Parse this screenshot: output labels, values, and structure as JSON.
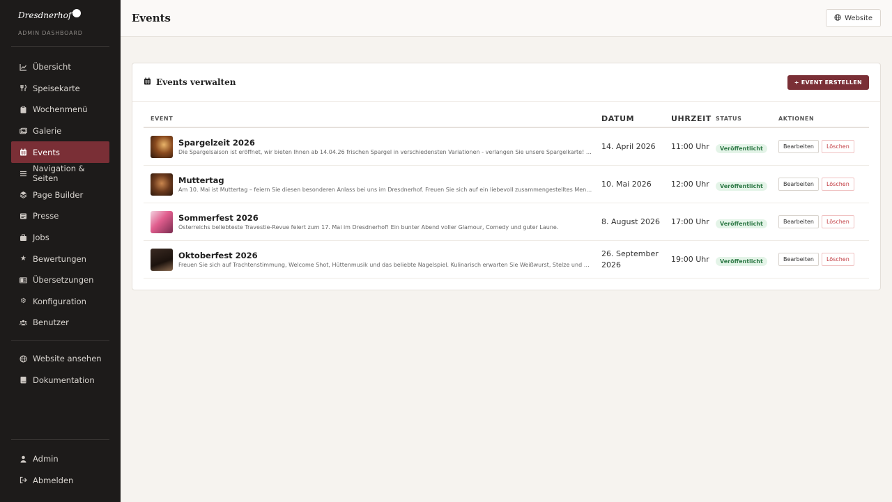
{
  "brand": {
    "logo_text": "Dresdnerhof",
    "subtitle": "ADMIN DASHBOARD"
  },
  "sidebar": {
    "items": [
      {
        "label": "Übersicht",
        "icon": "chart-line-icon"
      },
      {
        "label": "Speisekarte",
        "icon": "utensils-icon"
      },
      {
        "label": "Wochenmenü",
        "icon": "clipboard-icon"
      },
      {
        "label": "Galerie",
        "icon": "images-icon"
      },
      {
        "label": "Events",
        "icon": "calendar-icon"
      },
      {
        "label": "Navigation & Seiten",
        "icon": "bars-icon"
      },
      {
        "label": "Page Builder",
        "icon": "layers-icon"
      },
      {
        "label": "Presse",
        "icon": "newspaper-icon"
      },
      {
        "label": "Jobs",
        "icon": "briefcase-icon"
      },
      {
        "label": "Bewertungen",
        "icon": "star-icon"
      },
      {
        "label": "Übersetzungen",
        "icon": "language-icon"
      },
      {
        "label": "Konfiguration",
        "icon": "gear-icon"
      },
      {
        "label": "Benutzer",
        "icon": "users-icon"
      }
    ],
    "active": "Events",
    "links": [
      {
        "label": "Website ansehen",
        "icon": "globe-icon"
      },
      {
        "label": "Dokumentation",
        "icon": "book-icon"
      }
    ],
    "bottom": [
      {
        "label": "Admin",
        "icon": "user-icon"
      },
      {
        "label": "Abmelden",
        "icon": "logout-icon"
      }
    ]
  },
  "header": {
    "title": "Events",
    "website_label": "Website"
  },
  "card": {
    "title": "Events verwalten",
    "create_label": "+ EVENT ERSTELLEN",
    "columns": {
      "event": "EVENT",
      "date": "DATUM",
      "time": "UHRZEIT",
      "status": "STATUS",
      "actions": "AKTIONEN"
    },
    "rows": [
      {
        "title": "Spargelzeit 2026",
        "desc": "Die Spargelsaison ist eröffnet, wir bieten Ihnen ab 14.04.26 frischen Spargel in verschiedensten Variationen - verlangen Sie unsere Spargelkarte! Guten...",
        "date": "14. April 2026",
        "time": "11:00 Uhr",
        "status": "Veröffentlicht",
        "edit": "Bearbeiten",
        "delete": "Löschen"
      },
      {
        "title": "Muttertag",
        "desc": "Am 10. Mai ist Muttertag – feiern Sie diesen besonderen Anlass bei uns im Dresdnerhof. Freuen Sie sich auf ein liebevoll zusammengestelltes Menü und ein...",
        "date": "10. Mai 2026",
        "time": "12:00 Uhr",
        "status": "Veröffentlicht",
        "edit": "Bearbeiten",
        "delete": "Löschen"
      },
      {
        "title": "Sommerfest 2026",
        "desc": "Österreichs beliebteste Travestie-Revue feiert zum 17. Mai im Dresdnerhof! Ein bunter Abend voller Glamour, Comedy und guter Laune.",
        "date": "8. August 2026",
        "time": "17:00 Uhr",
        "status": "Veröffentlicht",
        "edit": "Bearbeiten",
        "delete": "Löschen"
      },
      {
        "title": "Oktoberfest 2026",
        "desc": "Freuen Sie sich auf Trachtenstimmung, Welcome Shot, Hüttenmusik und das beliebte Nagelspiel. Kulinarisch erwarten Sie Weißwurst, Stelze und vieles me...",
        "date": "26. September 2026",
        "time": "19:00 Uhr",
        "status": "Veröffentlicht",
        "edit": "Bearbeiten",
        "delete": "Löschen"
      }
    ]
  },
  "colors": {
    "accent": "#7a2f36",
    "sidebar_bg": "#1d1b1a",
    "success": "#2f7a47"
  }
}
